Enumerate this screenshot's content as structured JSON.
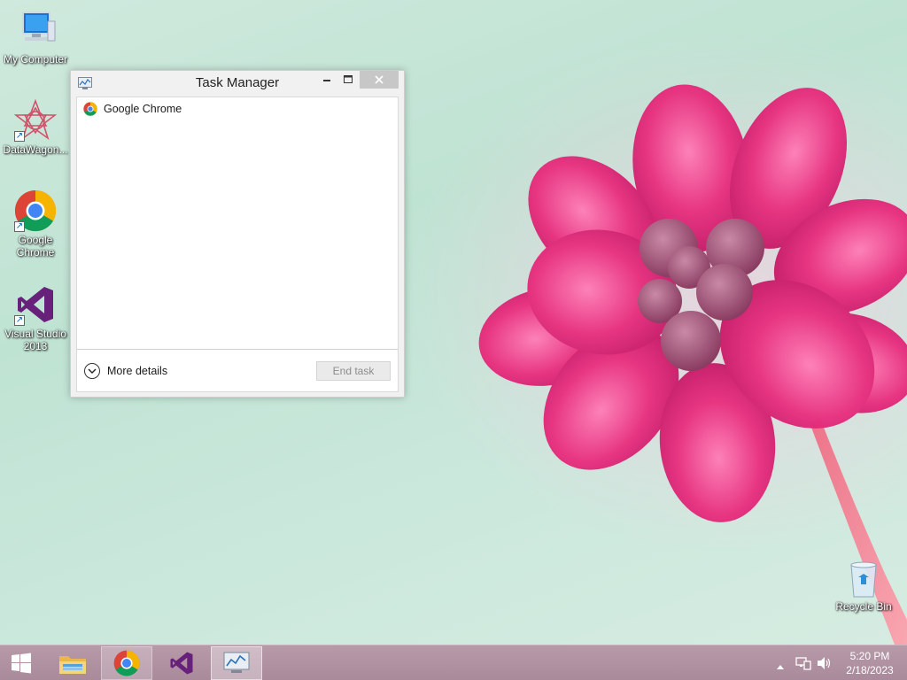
{
  "desktop": {
    "icons": [
      {
        "label": "My Computer"
      },
      {
        "label": "DataWagon..."
      },
      {
        "label": "Google Chrome"
      },
      {
        "label": "Visual Studio 2013"
      },
      {
        "label": "Recycle Bin"
      }
    ]
  },
  "task_manager": {
    "title": "Task Manager",
    "processes": [
      {
        "name": "Google Chrome",
        "icon": "chrome-icon"
      }
    ],
    "more_details_label": "More details",
    "end_task_label": "End task",
    "end_task_enabled": false
  },
  "taskbar": {
    "start_icon": "windows-logo-icon",
    "pinned": [
      {
        "name": "File Explorer",
        "icon": "folder-icon"
      },
      {
        "name": "Google Chrome",
        "icon": "chrome-icon",
        "running": true
      },
      {
        "name": "Visual Studio",
        "icon": "visual-studio-icon"
      },
      {
        "name": "Task Manager",
        "icon": "task-manager-icon",
        "active": true
      }
    ],
    "clock": {
      "time": "5:20 PM",
      "date": "2/18/2023"
    }
  },
  "colors": {
    "accent_vs": "#68217a",
    "chrome_red": "#db4437",
    "chrome_green": "#0f9d58",
    "chrome_yellow": "#f4b400",
    "chrome_blue": "#4285f4"
  }
}
